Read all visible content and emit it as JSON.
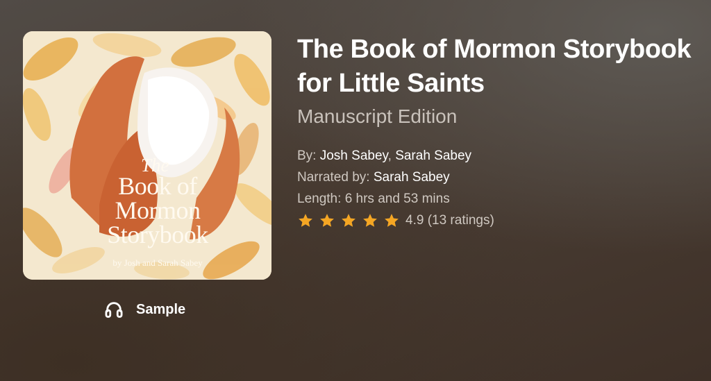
{
  "book": {
    "title": "The Book of Mormon Storybook for Little Saints",
    "subtitle": "Manuscript Edition",
    "cover": {
      "the": "The",
      "line1": "Book of",
      "line2": "Mormon",
      "line3": "Storybook",
      "authors": "by Josh and Sarah Sabey"
    }
  },
  "meta": {
    "by_label": "By:",
    "authors": [
      "Josh Sabey",
      "Sarah Sabey"
    ],
    "author_separator": ",",
    "narrated_label": "Narrated by:",
    "narrator": "Sarah Sabey",
    "length_label": "Length:",
    "length": "6 hrs and 53 mins"
  },
  "rating": {
    "value": 4.9,
    "stars_filled": 4.9,
    "stars_total": 5,
    "text": "4.9 (13 ratings)"
  },
  "sample": {
    "label": "Sample",
    "icon": "headphones-icon"
  },
  "colors": {
    "star": "#f5a623",
    "title": "#ffffff",
    "subtitle": "#c9c2bb"
  }
}
